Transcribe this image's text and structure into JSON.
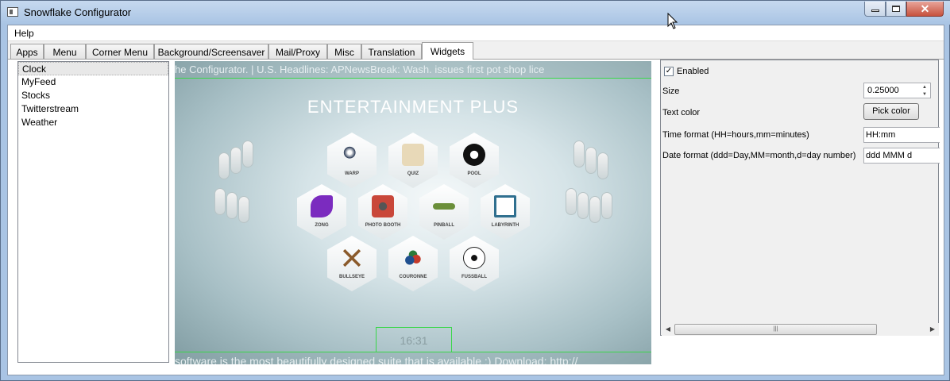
{
  "window": {
    "title": "Snowflake Configurator"
  },
  "menu": {
    "help": "Help"
  },
  "tabs": [
    {
      "label": "Apps"
    },
    {
      "label": "Menu"
    },
    {
      "label": "Corner Menu"
    },
    {
      "label": "Background/Screensaver"
    },
    {
      "label": "Mail/Proxy"
    },
    {
      "label": "Misc"
    },
    {
      "label": "Translation"
    },
    {
      "label": "Widgets"
    }
  ],
  "active_tab": "Widgets",
  "widgets": [
    "Clock",
    "MyFeed",
    "Stocks",
    "Twitterstream",
    "Weather"
  ],
  "selected_widget": "Clock",
  "preview": {
    "ticker_top": "he Configurator.   |   U.S. Headlines:     APNewsBreak: Wash. issues first pot shop lice",
    "ticker_bottom": "software is the most beautifully designed suite that is available :) Download: http://",
    "heading": "ENTERTAINMENT PLUS",
    "apps": [
      "WARP",
      "QUIZ",
      "POOL",
      "ZONG",
      "PHOTO BOOTH",
      "PINBALL",
      "LABYRINTH",
      "BULLSEYE",
      "COURONNE",
      "FUSSBALL"
    ],
    "clock": "16:31"
  },
  "properties": {
    "enabled_label": "Enabled",
    "enabled": true,
    "check_mark": "✓",
    "size_label": "Size",
    "size_value": "0.25000",
    "text_color_label": "Text color",
    "pick_color_label": "Pick color",
    "time_format_label": "Time format (HH=hours,mm=minutes)",
    "time_format_value": "HH:mm",
    "date_format_label": "Date format (ddd=Day,MM=month,d=day number)",
    "date_format_value": "ddd MMM d"
  },
  "colors": {
    "highlight_box": "#3ad64a",
    "title_bar": "#a9c4e4",
    "close_button": "#c7523e"
  }
}
